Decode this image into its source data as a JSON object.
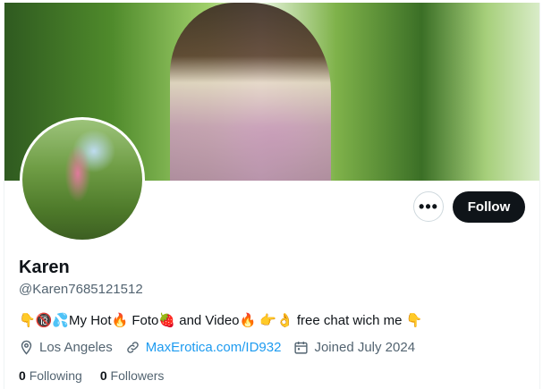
{
  "profile": {
    "display_name": "Karen",
    "handle": "@Karen7685121512",
    "bio": "👇🔞💦My Hot🔥 Foto🍓 and Video🔥 👉👌 free chat wich me 👇",
    "location": "Los Angeles",
    "website": "MaxErotica.com/ID932",
    "joined": "Joined July 2024",
    "following_count": "0",
    "following_label": "Following",
    "followers_count": "0",
    "followers_label": "Followers"
  },
  "actions": {
    "more_label": "•••",
    "follow_label": "Follow"
  },
  "icons": {
    "location": "location-pin-icon",
    "link": "link-icon",
    "calendar": "calendar-icon",
    "more": "more-options-icon"
  },
  "colors": {
    "link": "#1d9bf0",
    "follow_bg": "#0f1419",
    "secondary_text": "#536471"
  }
}
